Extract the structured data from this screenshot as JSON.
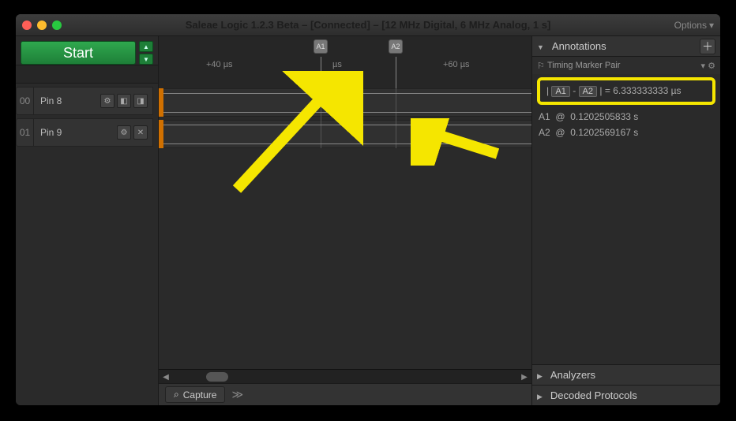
{
  "title": "Saleae Logic 1.2.3 Beta – [Connected] – [12 MHz Digital, 6 MHz Analog, 1 s]",
  "options_label": "Options",
  "start_label": "Start",
  "ruler": {
    "t40": "+40 µs",
    "t50": "µs",
    "t60": "+60 µs"
  },
  "channels": [
    {
      "index": "00",
      "name": "Pin 8",
      "has_trigger": true
    },
    {
      "index": "01",
      "name": "Pin 9",
      "has_trigger": false
    }
  ],
  "bottom_tab": "Capture",
  "right": {
    "annotations_title": "Annotations",
    "pair_title": "Timing Marker Pair",
    "m1": "A1",
    "m2": "A2",
    "diff_value": "6.333333333 µs",
    "a1_time": "0.1202505833 s",
    "a2_time": "0.1202569167 s",
    "analyzers_title": "Analyzers",
    "decoded_title": "Decoded Protocols"
  }
}
